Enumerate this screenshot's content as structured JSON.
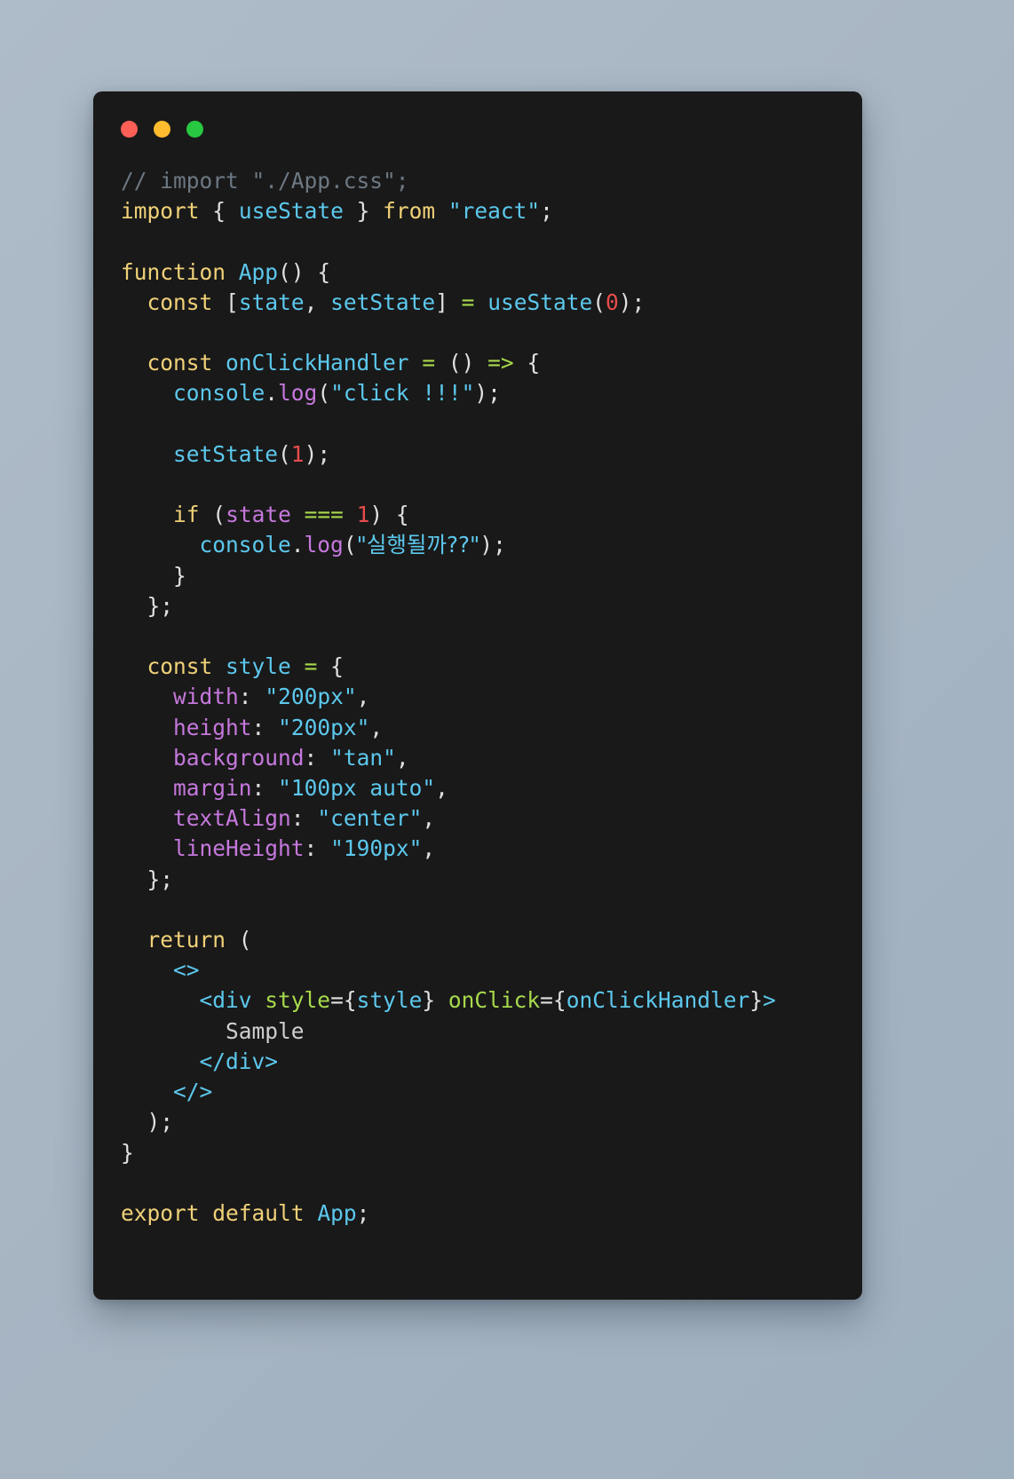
{
  "window": {
    "background_color": "#191919",
    "page_background_color": "#aebbc8",
    "traffic_lights": [
      {
        "name": "close",
        "color": "#ff5f57"
      },
      {
        "name": "minimize",
        "color": "#febc2e"
      },
      {
        "name": "maximize",
        "color": "#28c840"
      }
    ]
  },
  "code": {
    "language": "jsx",
    "filename_hint": "App.js",
    "lines": [
      "// import \"./App.css\";",
      "import { useState } from \"react\";",
      "",
      "function App() {",
      "  const [state, setState] = useState(0);",
      "",
      "  const onClickHandler = () => {",
      "    console.log(\"click !!!\");",
      "",
      "    setState(1);",
      "",
      "    if (state === 1) {",
      "      console.log(\"실행될까??\");",
      "    }",
      "  };",
      "",
      "  const style = {",
      "    width: \"200px\",",
      "    height: \"200px\",",
      "    background: \"tan\",",
      "    margin: \"100px auto\",",
      "    textAlign: \"center\",",
      "    lineHeight: \"190px\",",
      "  };",
      "",
      "  return (",
      "    <>",
      "      <div style={style} onClick={onClickHandler}>",
      "        Sample",
      "      </div>",
      "    </>",
      "  );",
      "}",
      "",
      "export default App;"
    ],
    "tokens": {
      "comment_text": "// import \"./App.css\";",
      "import_keyword": "import",
      "from_keyword": "from",
      "react_module": "\"react\"",
      "use_state": "useState",
      "function_keyword": "function",
      "component_name": "App",
      "const_keyword": "const",
      "state_var": "state",
      "set_state_var": "setState",
      "initial_state_value": "0",
      "handler_name": "onClickHandler",
      "arrow": "=>",
      "console_object": "console",
      "log_method": "log",
      "click_log_string": "\"click !!!\"",
      "set_state_arg": "1",
      "if_keyword": "if",
      "strict_equals": "===",
      "compare_value": "1",
      "korean_log_string": "\"실행될까??\"",
      "style_var": "style",
      "style_props": [
        {
          "key": "width",
          "value": "\"200px\""
        },
        {
          "key": "height",
          "value": "\"200px\""
        },
        {
          "key": "background",
          "value": "\"tan\""
        },
        {
          "key": "margin",
          "value": "\"100px auto\""
        },
        {
          "key": "textAlign",
          "value": "\"center\""
        },
        {
          "key": "lineHeight",
          "value": "\"190px\""
        }
      ],
      "return_keyword": "return",
      "fragment_open": "<>",
      "fragment_close": "</>",
      "div_open_tag": "<div",
      "div_close_tag": "</div>",
      "style_attr": "style",
      "on_click_attr": "onClick",
      "jsx_text": "Sample",
      "export_keyword": "export",
      "default_keyword": "default",
      "export_name": "App"
    },
    "colors": {
      "comment": "#6d7882",
      "keyword": "#f0d178",
      "identifier": "#5cc8ed",
      "string": "#5cc8ed",
      "punctuation": "#e0e0e0",
      "number": "#e74c4c",
      "operator": "#a7d94c",
      "method": "#c678dd",
      "property": "#c678dd",
      "jsx_attribute": "#a7d94c",
      "plain_text": "#cfcfcf"
    }
  }
}
